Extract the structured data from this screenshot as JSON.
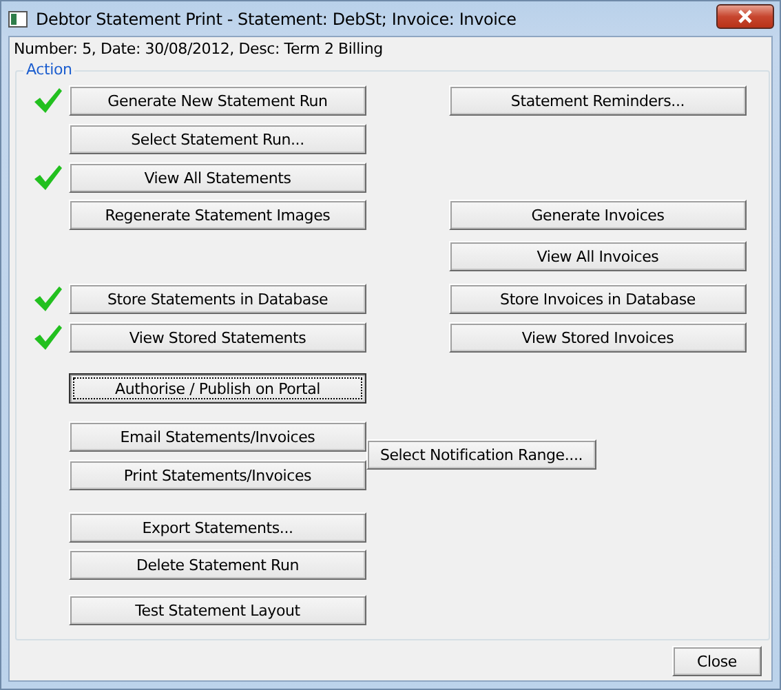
{
  "window": {
    "title": "Debtor Statement Print - Statement: DebSt;  Invoice: Invoice"
  },
  "info": "Number: 5, Date: 30/08/2012, Desc: Term 2 Billing",
  "group": {
    "label": "Action",
    "rows": [
      {
        "done": true,
        "left": {
          "label": "Generate New Statement Run",
          "focused": false
        },
        "right": {
          "label": "Statement Reminders...",
          "focused": false
        }
      },
      {
        "done": false,
        "left": {
          "label": "Select Statement Run...",
          "focused": false
        }
      },
      {
        "done": true,
        "left": {
          "label": "View All Statements",
          "focused": false
        }
      },
      {
        "done": false,
        "left": {
          "label": "Regenerate Statement Images",
          "focused": false
        },
        "right": {
          "label": "Generate Invoices",
          "focused": false
        }
      },
      {
        "done": false,
        "right": {
          "label": "View All Invoices",
          "focused": false
        }
      },
      {
        "done": true,
        "left": {
          "label": "Store Statements in Database",
          "focused": false
        },
        "right": {
          "label": "Store Invoices in Database",
          "focused": false
        }
      },
      {
        "done": true,
        "left": {
          "label": "View Stored Statements",
          "focused": false
        },
        "right": {
          "label": "View Stored Invoices",
          "focused": false
        }
      },
      {
        "done": false,
        "left": {
          "label": "Authorise / Publish on Portal",
          "focused": true
        }
      },
      {
        "done": false,
        "left": {
          "label": "Email Statements/Invoices",
          "focused": false
        },
        "middle": {
          "label": "Select Notification Range....",
          "focused": false
        }
      },
      {
        "done": false,
        "left": {
          "label": "Print Statements/Invoices",
          "focused": false
        }
      },
      {
        "done": false,
        "left": {
          "label": "Export Statements...",
          "focused": false
        }
      },
      {
        "done": false,
        "left": {
          "label": "Delete Statement Run",
          "focused": false
        }
      },
      {
        "done": false,
        "left": {
          "label": "Test Statement Layout",
          "focused": false
        }
      }
    ]
  },
  "footer": {
    "buttons": [
      "Close"
    ]
  }
}
